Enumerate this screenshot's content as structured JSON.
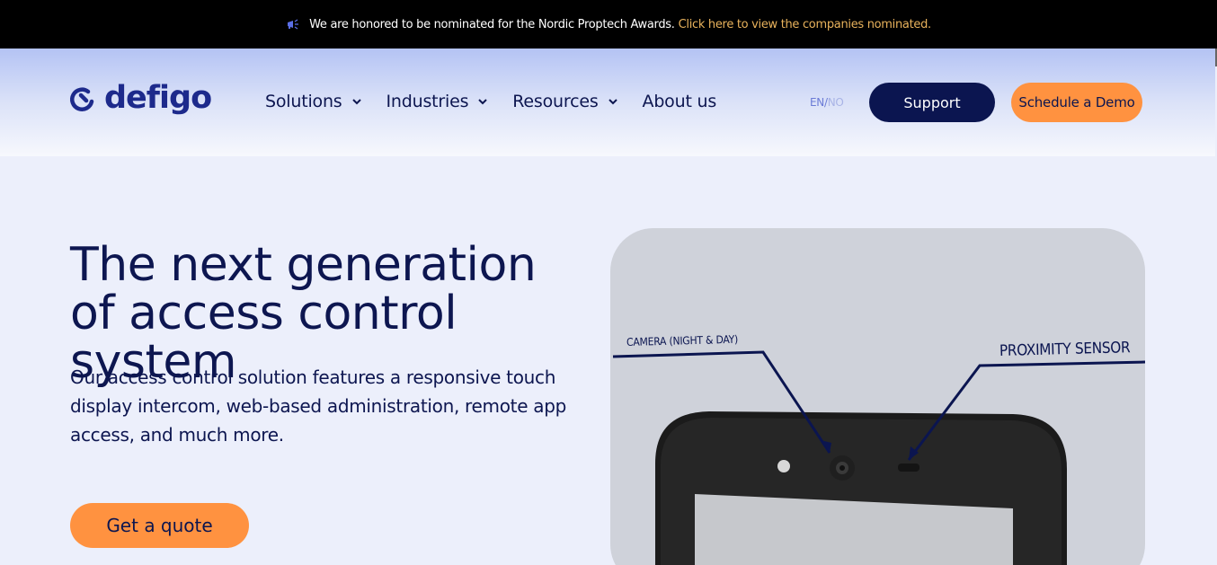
{
  "announcement": {
    "icon": "megaphone-icon",
    "message": "We are honored to be nominated for the Nordic Proptech Awards.",
    "link_text": "Click here to view the companies nominated."
  },
  "header": {
    "logo_text": "defigo",
    "nav": [
      {
        "label": "Solutions",
        "has_dropdown": true
      },
      {
        "label": "Industries",
        "has_dropdown": true
      },
      {
        "label": "Resources",
        "has_dropdown": true
      },
      {
        "label": "About us",
        "has_dropdown": false
      }
    ],
    "lang": {
      "en": "EN",
      "sep": "/",
      "no": "NO"
    },
    "support_label": "Support",
    "demo_label": "Schedule a Demo"
  },
  "hero": {
    "title": "The next generation of access control system",
    "description": "Our access control solution features a responsive touch display intercom, web-based administration, remote app access, and much more.",
    "cta_label": "Get a quote"
  },
  "device_image": {
    "camera_label": "CAMERA (NIGHT & DAY)",
    "proximity_label": "PROXIMITY SENSOR"
  },
  "colors": {
    "navy": "#0b1550",
    "orange": "#ff9240",
    "link_gold": "#e8b25c",
    "background": "#eceffb"
  }
}
